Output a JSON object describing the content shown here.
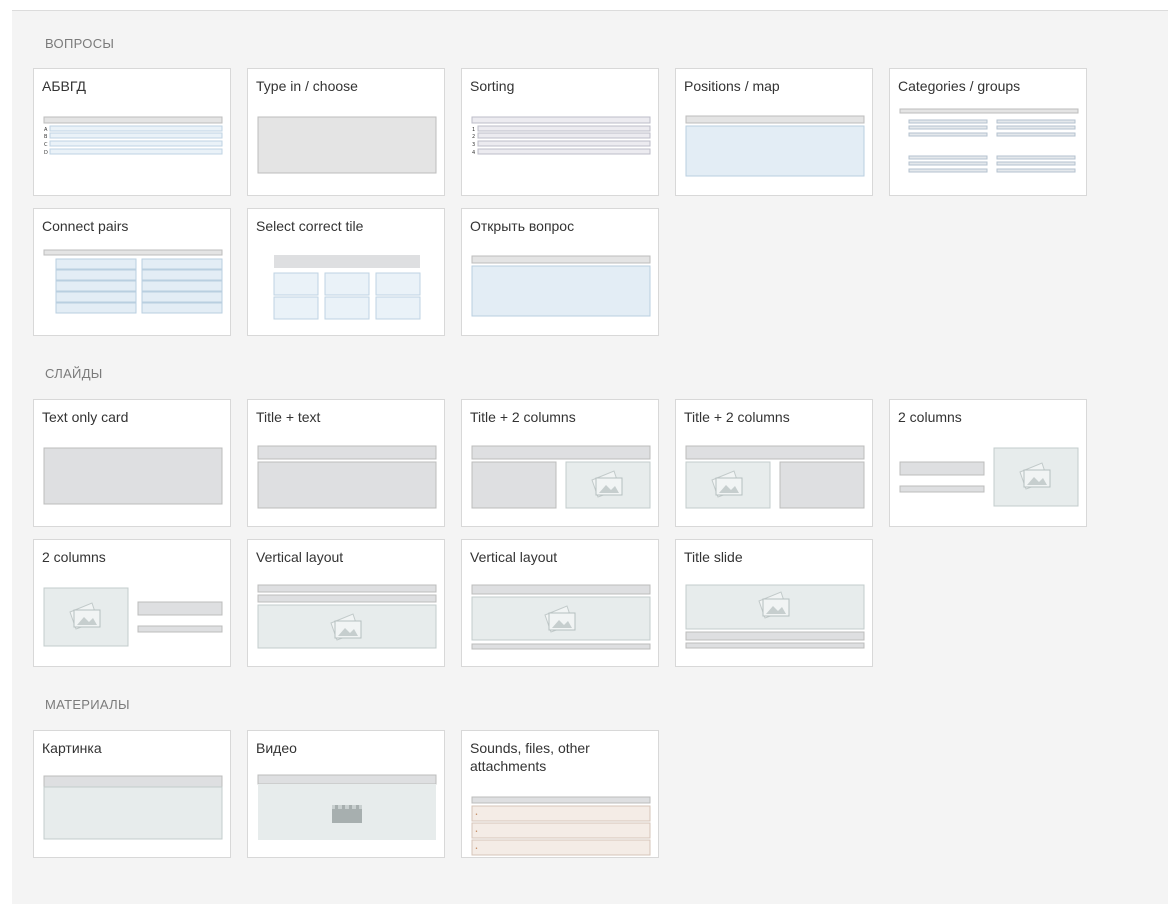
{
  "sections": [
    {
      "title": "ВОПРОСЫ",
      "cards": [
        {
          "label": "АБВГД",
          "markers": [
            "A",
            "B",
            "C",
            "D"
          ]
        },
        {
          "label": "Type in / choose"
        },
        {
          "label": "Sorting",
          "markers": [
            "1",
            "2",
            "3",
            "4"
          ]
        },
        {
          "label": "Positions / map"
        },
        {
          "label": "Categories / groups"
        },
        {
          "label": "Connect pairs"
        },
        {
          "label": "Select correct tile"
        },
        {
          "label": "Открыть вопрос"
        }
      ]
    },
    {
      "title": "СЛАЙДЫ",
      "cards": [
        {
          "label": "Text only card"
        },
        {
          "label": "Title + text"
        },
        {
          "label": "Title + 2 columns"
        },
        {
          "label": "Title + 2 columns"
        },
        {
          "label": "2 columns"
        },
        {
          "label": "2 columns"
        },
        {
          "label": "Vertical layout"
        },
        {
          "label": "Vertical layout"
        },
        {
          "label": "Title slide"
        }
      ]
    },
    {
      "title": "МАТЕРИАЛЫ",
      "cards": [
        {
          "label": "Картинка"
        },
        {
          "label": "Видео"
        },
        {
          "label": "Sounds, files, other attachments",
          "markers": [
            "•",
            "•",
            "•"
          ]
        }
      ]
    }
  ],
  "colors": {
    "background": "#f4f4f4",
    "card": "#ffffff",
    "card_border": "#d8d8d8",
    "section_title": "#7b7b7b",
    "preview_blue": "#e3edf5",
    "preview_gray": "#dedfe1"
  },
  "icons": [
    "image-placeholder-icon",
    "clapperboard-icon"
  ]
}
